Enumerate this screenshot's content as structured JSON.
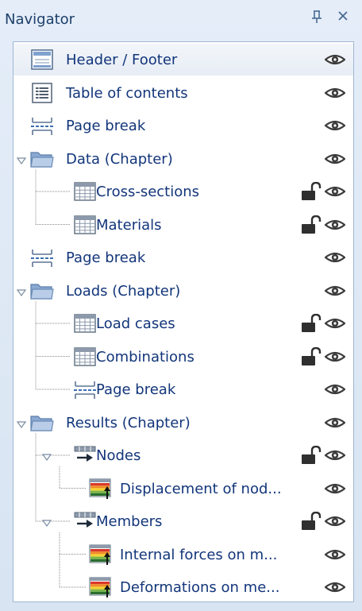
{
  "panel": {
    "title": "Navigator",
    "pin_glyph": "ᵖ",
    "close_glyph": "✕"
  },
  "colors": {
    "title_text": "#1e3f6b",
    "item_text": "#12357a",
    "panel_bg": "#dfe9f5",
    "tree_border": "#9fb6d3",
    "selected_bg": "#e7edf5"
  },
  "items": [
    {
      "label": "Header / Footer",
      "icon": "header-footer-icon",
      "level": 0,
      "selected": true,
      "lock": false
    },
    {
      "label": "Table of contents",
      "icon": "table-of-contents-icon",
      "level": 0,
      "selected": false,
      "lock": false
    },
    {
      "label": "Page break",
      "icon": "page-break-icon",
      "level": 0,
      "selected": false,
      "lock": false
    },
    {
      "label": "Data (Chapter)",
      "icon": "folder-icon",
      "level": 0,
      "expander": true,
      "selected": false,
      "lock": false
    },
    {
      "label": "Cross-sections",
      "icon": "table-icon",
      "level": 1,
      "selected": false,
      "lock": true
    },
    {
      "label": "Materials",
      "icon": "table-icon",
      "level": 1,
      "selected": false,
      "lock": true
    },
    {
      "label": "Page break",
      "icon": "page-break-icon",
      "level": 0,
      "selected": false,
      "lock": false
    },
    {
      "label": "Loads (Chapter)",
      "icon": "folder-icon",
      "level": 0,
      "expander": true,
      "selected": false,
      "lock": false
    },
    {
      "label": "Load cases",
      "icon": "table-icon",
      "level": 1,
      "selected": false,
      "lock": true
    },
    {
      "label": "Combinations",
      "icon": "table-icon",
      "level": 1,
      "selected": false,
      "lock": true
    },
    {
      "label": "Page break",
      "icon": "page-break-icon",
      "level": 1,
      "selected": false,
      "lock": false
    },
    {
      "label": "Results (Chapter)",
      "icon": "folder-icon",
      "level": 0,
      "expander": true,
      "selected": false,
      "lock": false
    },
    {
      "label": "Nodes",
      "icon": "results-table-icon",
      "level": 1,
      "expander": true,
      "selected": false,
      "lock": true
    },
    {
      "label": "Displacement of nod...",
      "icon": "color-results-icon",
      "level": 2,
      "selected": false,
      "lock": false
    },
    {
      "label": "Members",
      "icon": "results-table-icon",
      "level": 1,
      "expander": true,
      "selected": false,
      "lock": true
    },
    {
      "label": "Internal forces on m...",
      "icon": "color-results-icon",
      "level": 2,
      "selected": false,
      "lock": false
    },
    {
      "label": "Deformations on me...",
      "icon": "color-results-icon",
      "level": 2,
      "selected": false,
      "lock": false
    }
  ]
}
